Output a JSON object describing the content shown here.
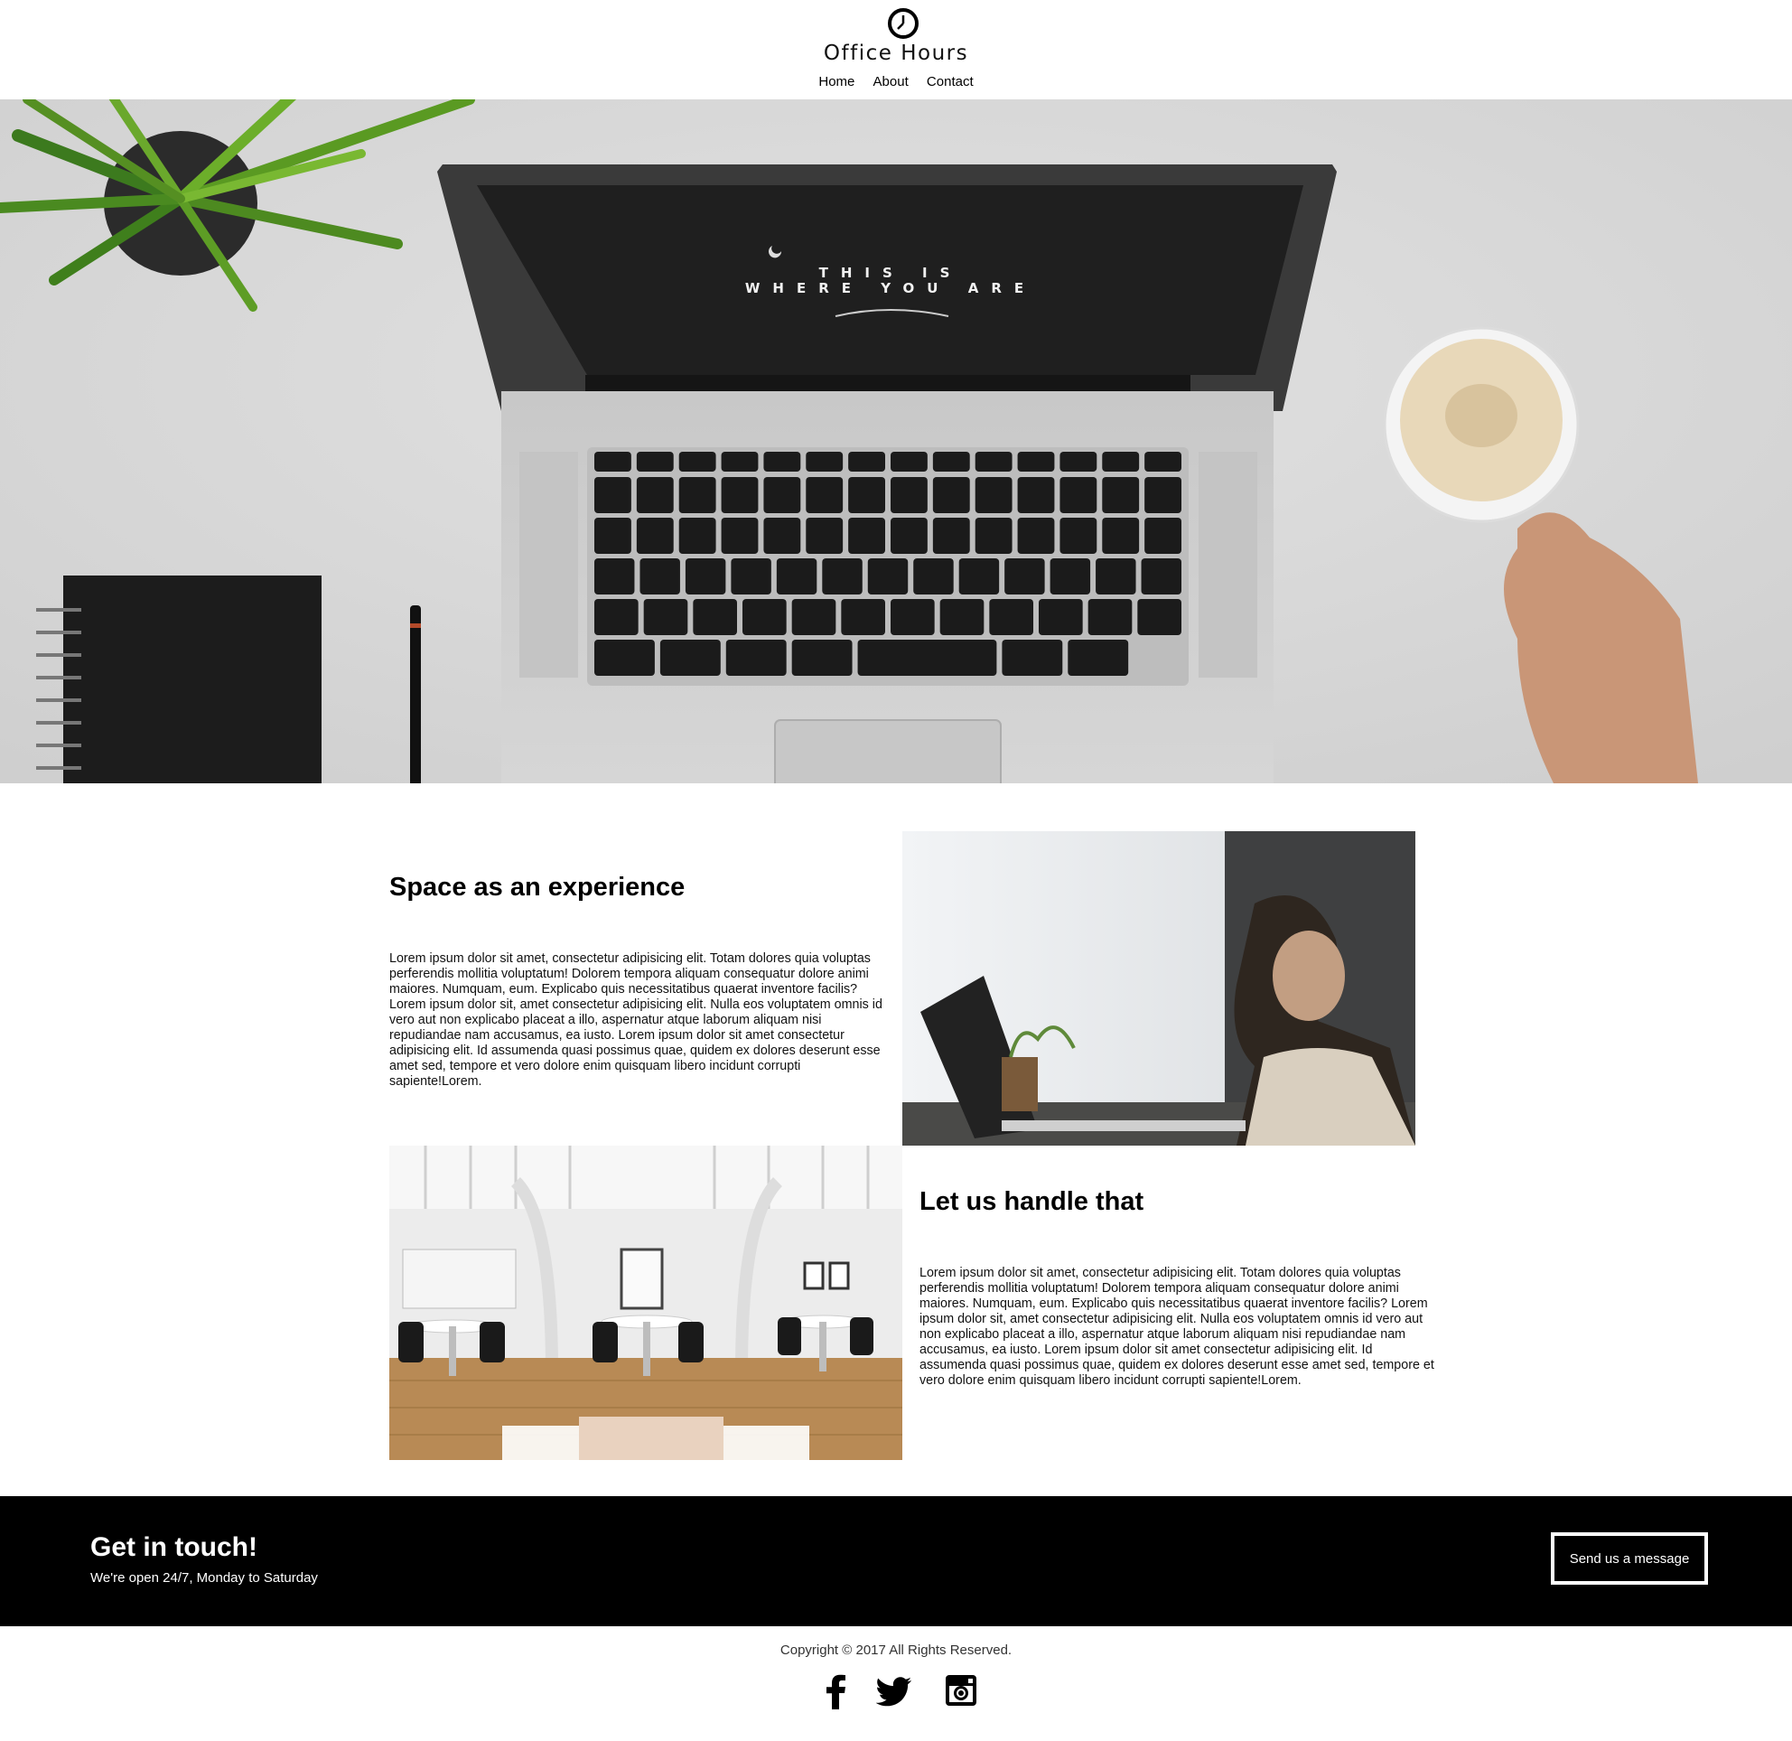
{
  "brand": {
    "name": "Office Hours",
    "logo_icon": "clock-icon"
  },
  "nav": {
    "items": [
      "Home",
      "About",
      "Contact"
    ]
  },
  "hero": {
    "screen_line1": "THIS IS",
    "screen_line2": "WHERE YOU ARE"
  },
  "features": [
    {
      "title": "Space as an experience",
      "body": "Lorem ipsum dolor sit amet, consectetur adipisicing elit. Totam dolores quia voluptas perferendis mollitia voluptatum! Dolorem tempora aliquam consequatur dolore animi maiores. Numquam, eum. Explicabo quis necessitatibus quaerat inventore facilis?Lorem ipsum dolor sit, amet consectetur adipisicing elit. Nulla eos voluptatem omnis id vero aut non explicabo placeat a illo, aspernatur atque laborum aliquam nisi repudiandae nam accusamus, ea iusto. Lorem ipsum dolor sit amet consectetur adipisicing elit. Id assumenda quasi possimus quae, quidem ex dolores deserunt esse amet sed, tempore et vero dolore enim quisquam libero incidunt corrupti sapiente!Lorem."
    },
    {
      "title": "Let us handle that",
      "body": "Lorem ipsum dolor sit amet, consectetur adipisicing elit. Totam dolores quia voluptas perferendis mollitia voluptatum! Dolorem tempora aliquam consequatur dolore animi maiores. Numquam, eum. Explicabo quis necessitatibus quaerat inventore facilis? Lorem ipsum dolor sit, amet consectetur adipisicing elit. Nulla eos voluptatem omnis id vero aut non explicabo placeat a illo, aspernatur atque laborum aliquam nisi repudiandae nam accusamus, ea iusto. Lorem ipsum dolor sit amet consectetur adipisicing elit. Id assumenda quasi possimus quae, quidem ex dolores deserunt esse amet sed, tempore et vero dolore enim quisquam libero incidunt corrupti sapiente!Lorem."
    }
  ],
  "contact": {
    "title": "Get in touch!",
    "subtitle": "We're open 24/7, Monday to Saturday",
    "button": "Send us a message"
  },
  "footer": {
    "copyright": "Copyright © 2017 All Rights Reserved.",
    "social": [
      "facebook-icon",
      "twitter-icon",
      "instagram-icon"
    ]
  }
}
